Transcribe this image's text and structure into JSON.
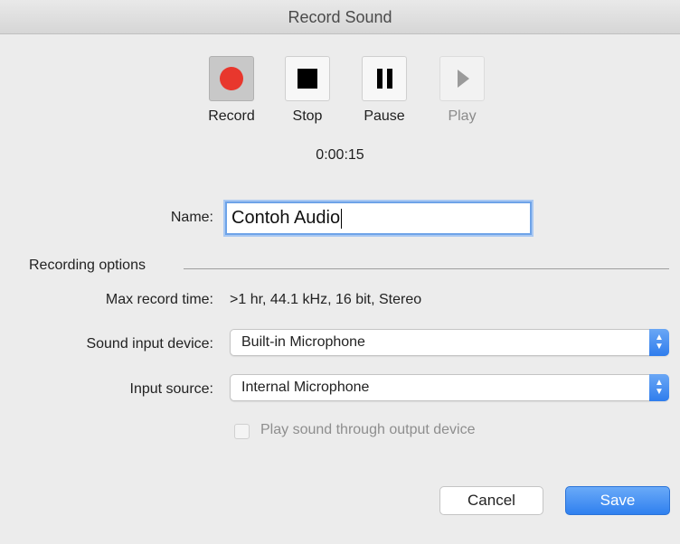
{
  "window": {
    "title": "Record Sound"
  },
  "transport": {
    "record_label": "Record",
    "stop_label": "Stop",
    "pause_label": "Pause",
    "play_label": "Play"
  },
  "timer": "0:00:15",
  "name": {
    "label": "Name:",
    "value": "Contoh Audio"
  },
  "options": {
    "title": "Recording options",
    "max_record_label": "Max record time:",
    "max_record_value": ">1 hr, 44.1 kHz, 16 bit, Stereo",
    "input_device_label": "Sound input device:",
    "input_device_value": "Built-in Microphone",
    "input_source_label": "Input source:",
    "input_source_value": "Internal Microphone",
    "play_through_label": "Play sound through output device",
    "play_through_checked": false
  },
  "buttons": {
    "cancel": "Cancel",
    "save": "Save"
  },
  "colors": {
    "accent": "#2f80ef",
    "record": "#e8372d"
  }
}
